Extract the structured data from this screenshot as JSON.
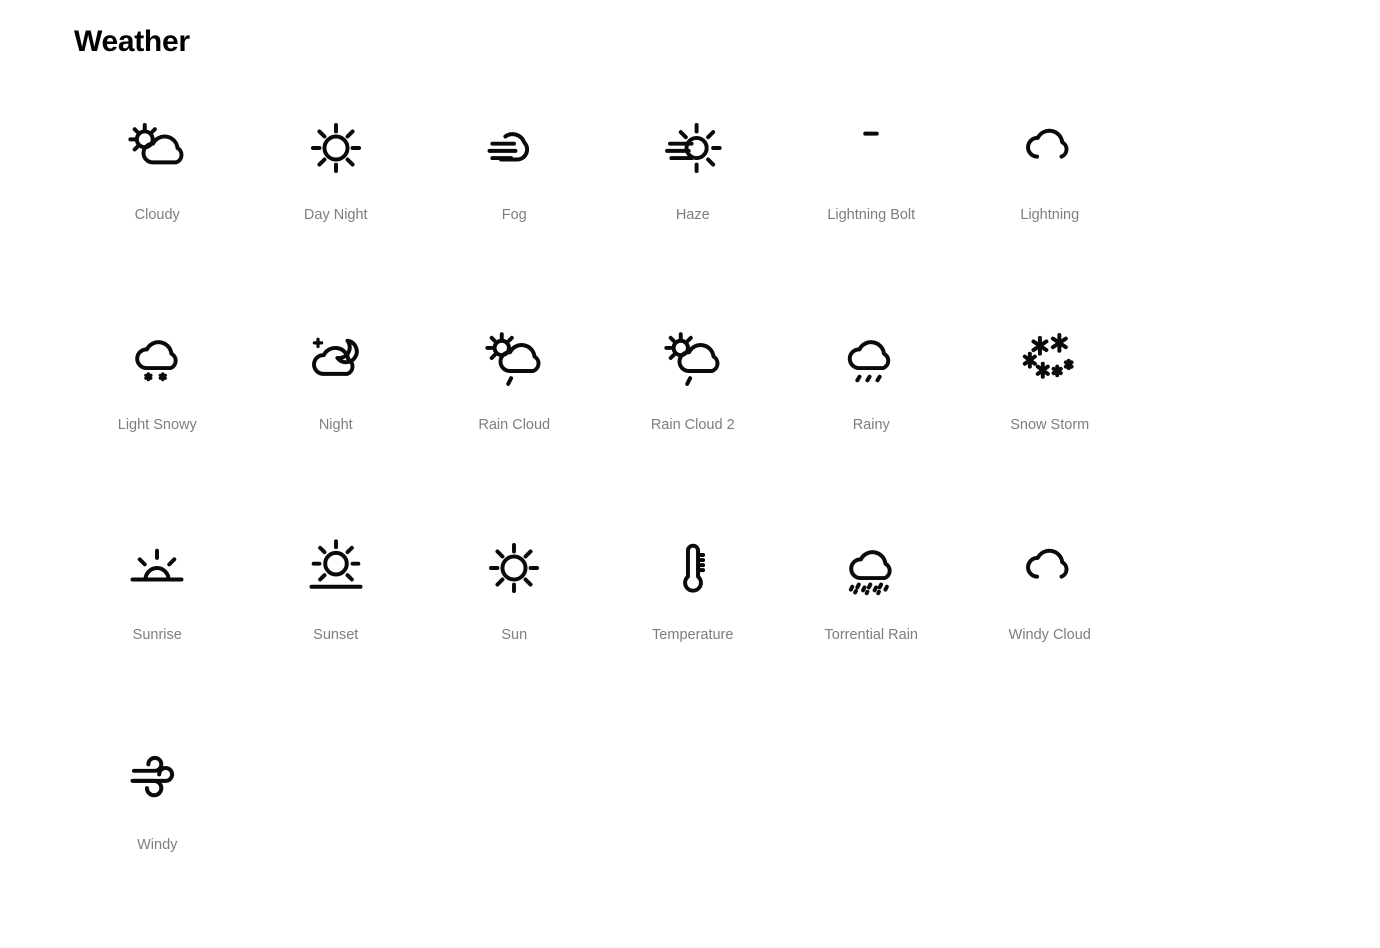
{
  "page": {
    "title": "Weather",
    "background_color": "#ffffff",
    "icon_stroke_color": "#0a0a0a",
    "label_color": "#7d7d84"
  },
  "grid": {
    "columns": 6,
    "rows": 4,
    "total_icons": 19
  },
  "icons": [
    {
      "label": "Cloudy",
      "icon_name": "cloudy-icon"
    },
    {
      "label": "Day Night",
      "icon_name": "day-night-icon"
    },
    {
      "label": "Fog",
      "icon_name": "fog-icon"
    },
    {
      "label": "Haze",
      "icon_name": "haze-icon"
    },
    {
      "label": "Lightning Bolt",
      "icon_name": "lightning-bolt-icon"
    },
    {
      "label": "Lightning",
      "icon_name": "lightning-icon"
    },
    {
      "label": "Light Snowy",
      "icon_name": "light-snowy-icon"
    },
    {
      "label": "Night",
      "icon_name": "night-icon"
    },
    {
      "label": "Rain Cloud",
      "icon_name": "rain-cloud-icon"
    },
    {
      "label": "Rain Cloud 2",
      "icon_name": "rain-cloud-2-icon"
    },
    {
      "label": "Rainy",
      "icon_name": "rainy-icon"
    },
    {
      "label": "Snow Storm",
      "icon_name": "snow-storm-icon"
    },
    {
      "label": "Sunrise",
      "icon_name": "sunrise-icon"
    },
    {
      "label": "Sunset",
      "icon_name": "sunset-icon"
    },
    {
      "label": "Sun",
      "icon_name": "sun-icon"
    },
    {
      "label": "Temperature",
      "icon_name": "temperature-icon"
    },
    {
      "label": "Torrential Rain",
      "icon_name": "torrential-rain-icon"
    },
    {
      "label": "Windy Cloud",
      "icon_name": "windy-cloud-icon"
    },
    {
      "label": "Windy",
      "icon_name": "windy-icon"
    }
  ]
}
